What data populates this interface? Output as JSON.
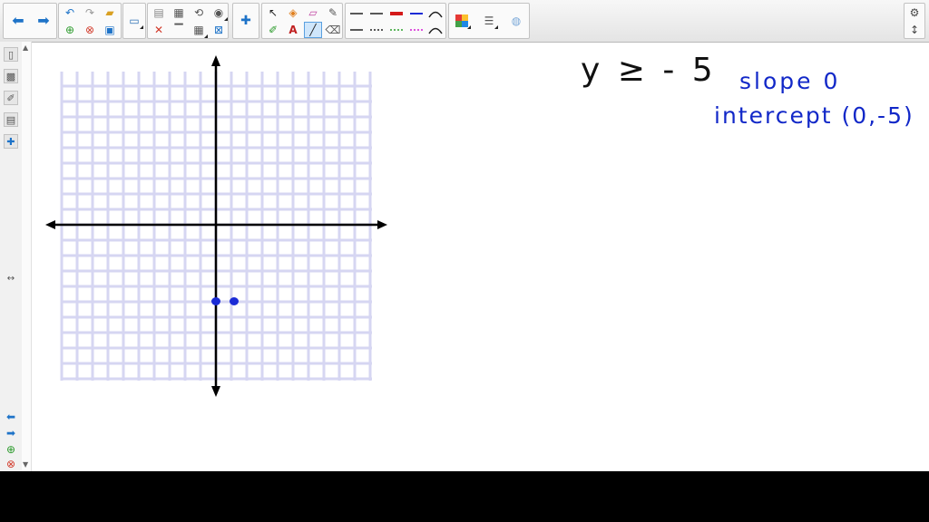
{
  "toolbar": {
    "groups": [
      {
        "name": "navigation",
        "items": [
          "back-arrow-icon",
          "forward-arrow-icon"
        ]
      },
      {
        "name": "edit",
        "items": [
          "undo-icon",
          "redo-icon",
          "open-folder-icon",
          "add-page-icon",
          "delete-page-icon",
          "save-icon"
        ]
      },
      {
        "name": "view",
        "items": [
          "screen-icon"
        ]
      },
      {
        "name": "page",
        "items": [
          "paste-icon",
          "screen-capture-icon",
          "rotate-icon",
          "record-icon",
          "close-x-icon",
          "screen-shade-icon",
          "table-icon",
          "fit-icon"
        ]
      },
      {
        "name": "addons",
        "items": [
          "puzzle-icon"
        ]
      },
      {
        "name": "tools",
        "items": [
          "select-arrow-icon",
          "fill-icon",
          "eraser-icon",
          "magic-pen-icon",
          "pens-icon",
          "text-icon",
          "line-icon",
          "shape-eraser-icon"
        ]
      },
      {
        "name": "line-styles",
        "items": [
          "line-plain-icon",
          "line-arrow-both-icon",
          "line-red-thick-icon",
          "line-blue-dots-icon",
          "line-curve-icon",
          "line-arrow-right-icon",
          "line-dashed-icon",
          "line-green-dashed-icon",
          "line-magenta-dashed-icon",
          "line-curve-2-icon"
        ]
      },
      {
        "name": "properties",
        "items": [
          "color-palette-icon",
          "line-thickness-icon",
          "transparency-icon"
        ]
      }
    ],
    "settings_icon": "gear-icon",
    "move_icon": "up-down-arrow-icon"
  },
  "sidebar": {
    "tabs": [
      "page-sorter-icon",
      "gallery-icon",
      "attachments-icon",
      "properties-icon",
      "addons-icon"
    ],
    "resize_handle": "↔",
    "bottom": [
      "back-arrow-icon",
      "forward-arrow-icon",
      "add-page-icon",
      "delete-page-icon"
    ]
  },
  "canvas": {
    "equation": "y ≥ - 5",
    "slope_text": "slope  0",
    "intercept_text": "intercept (0,-5)",
    "colors": {
      "grid": "#d6d6f2",
      "axes": "#000000",
      "ink_blue": "#1228c8",
      "points": "#1a2bd6"
    }
  },
  "chart_data": {
    "type": "scatter",
    "title": "",
    "xlabel": "",
    "ylabel": "",
    "xlim": [
      -10,
      10
    ],
    "ylim": [
      -11,
      10
    ],
    "grid": true,
    "series": [
      {
        "values": [
          {
            "x": 0,
            "y": -5
          },
          {
            "x": 1,
            "y": -5
          }
        ]
      }
    ]
  }
}
